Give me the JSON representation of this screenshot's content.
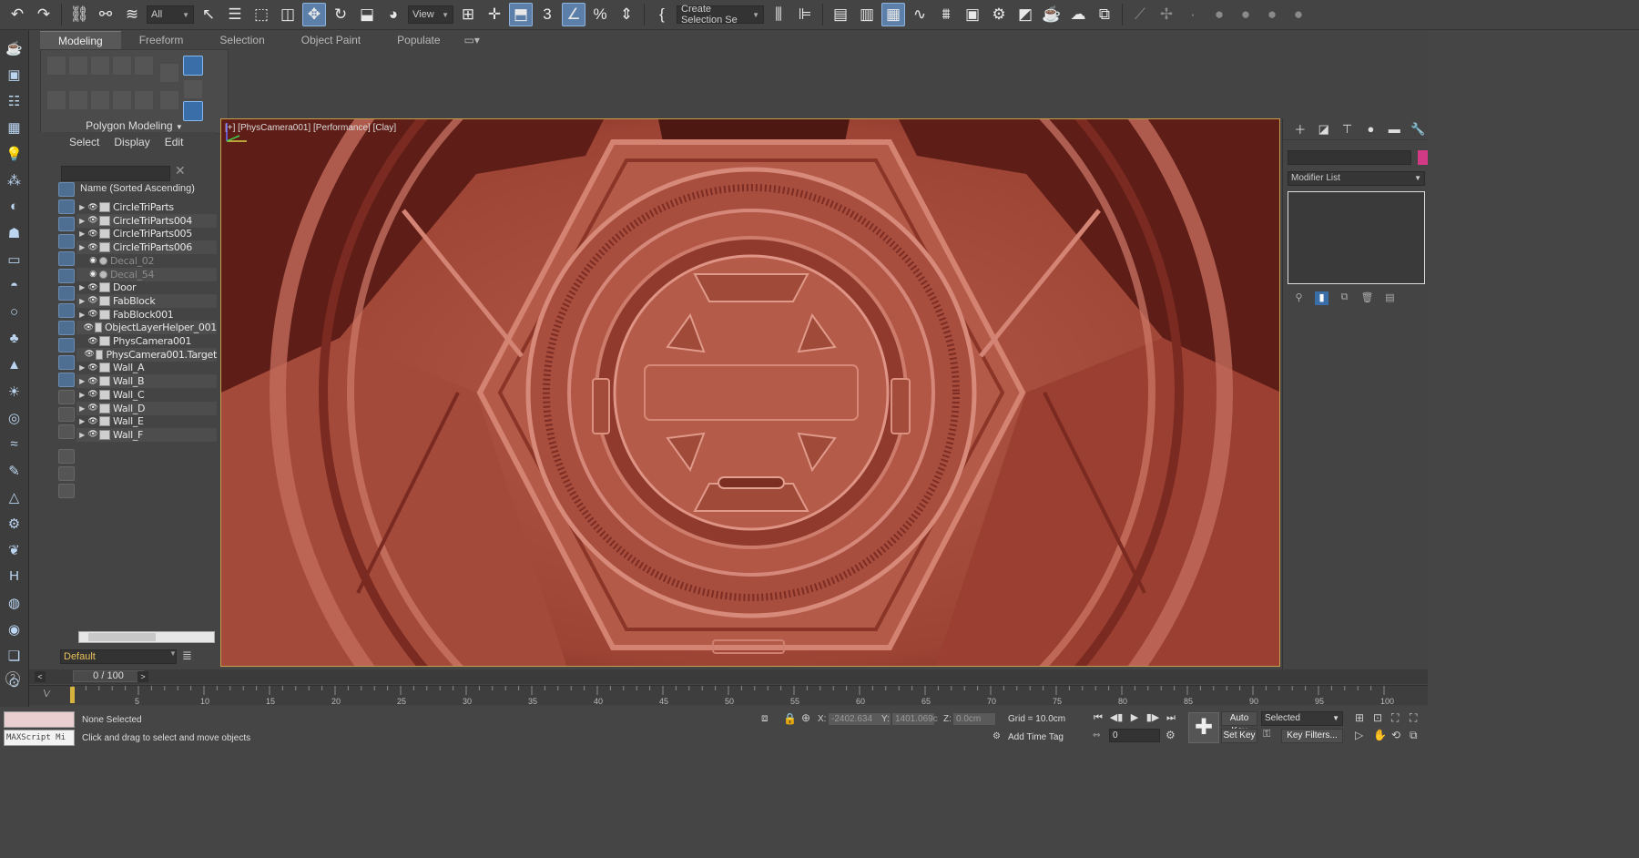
{
  "toolbar": {
    "filter_dropdown": "All",
    "refcoord_dropdown": "View",
    "selection_set": "Create Selection Se"
  },
  "ribbon": {
    "tabs": [
      "Modeling",
      "Freeform",
      "Selection",
      "Object Paint",
      "Populate"
    ],
    "active_tab": "Modeling",
    "panel_label": "Polygon Modeling"
  },
  "explorer": {
    "menu": [
      "Select",
      "Display",
      "Edit"
    ],
    "column_header": "Name (Sorted Ascending)",
    "rows": [
      {
        "label": "CircleTriParts",
        "hidden": false,
        "expandable": true,
        "kind": "group"
      },
      {
        "label": "CircleTriParts004",
        "hidden": false,
        "expandable": true,
        "kind": "group"
      },
      {
        "label": "CircleTriParts005",
        "hidden": false,
        "expandable": true,
        "kind": "group"
      },
      {
        "label": "CircleTriParts006",
        "hidden": false,
        "expandable": true,
        "kind": "group"
      },
      {
        "label": "Decal_02",
        "hidden": true,
        "expandable": false,
        "kind": "decal"
      },
      {
        "label": "Decal_54",
        "hidden": true,
        "expandable": false,
        "kind": "decal"
      },
      {
        "label": "Door",
        "hidden": false,
        "expandable": true,
        "kind": "group"
      },
      {
        "label": "FabBlock",
        "hidden": false,
        "expandable": true,
        "kind": "group"
      },
      {
        "label": "FabBlock001",
        "hidden": false,
        "expandable": true,
        "kind": "group"
      },
      {
        "label": "ObjectLayerHelper_001",
        "hidden": false,
        "expandable": false,
        "kind": "helper"
      },
      {
        "label": "PhysCamera001",
        "hidden": false,
        "expandable": false,
        "kind": "camera"
      },
      {
        "label": "PhysCamera001.Target",
        "hidden": false,
        "expandable": false,
        "kind": "camera"
      },
      {
        "label": "Wall_A",
        "hidden": false,
        "expandable": true,
        "kind": "group"
      },
      {
        "label": "Wall_B",
        "hidden": false,
        "expandable": true,
        "kind": "group"
      },
      {
        "label": "Wall_C",
        "hidden": false,
        "expandable": true,
        "kind": "group"
      },
      {
        "label": "Wall_D",
        "hidden": false,
        "expandable": true,
        "kind": "group"
      },
      {
        "label": "Wall_E",
        "hidden": false,
        "expandable": true,
        "kind": "group"
      },
      {
        "label": "Wall_F",
        "hidden": false,
        "expandable": true,
        "kind": "group"
      }
    ],
    "layer": "Default"
  },
  "viewport": {
    "label": "[+] [PhysCamera001] [Performance] [Clay]"
  },
  "command_panel": {
    "modifier_list": "Modifier List",
    "object_color": "#d23a86"
  },
  "timeline": {
    "frame_display": "0 / 100",
    "ticks": [
      "5",
      "10",
      "15",
      "20",
      "25",
      "30",
      "35",
      "40",
      "45",
      "50",
      "55",
      "60",
      "65",
      "70",
      "75",
      "80",
      "85",
      "90",
      "95",
      "100"
    ]
  },
  "status": {
    "maxscript_label": "MAXScript Mi",
    "selection": "None Selected",
    "hint": "Click and drag to select and move objects",
    "x_label": "X:",
    "x_value": "-2402.634",
    "y_label": "Y:",
    "y_value": "1401.069c",
    "z_label": "Z:",
    "z_value": "0.0cm",
    "grid": "Grid = 10.0cm",
    "add_time_tag": "Add Time Tag",
    "auto_key": "Auto Key",
    "set_key": "Set Key",
    "key_mode": "Selected",
    "key_filters": "Key Filters...",
    "current_frame": "0"
  },
  "colors": {
    "clay": "#a54a3b",
    "viewport_border": "#c6a04c",
    "active_button": "#5b7fa8"
  }
}
